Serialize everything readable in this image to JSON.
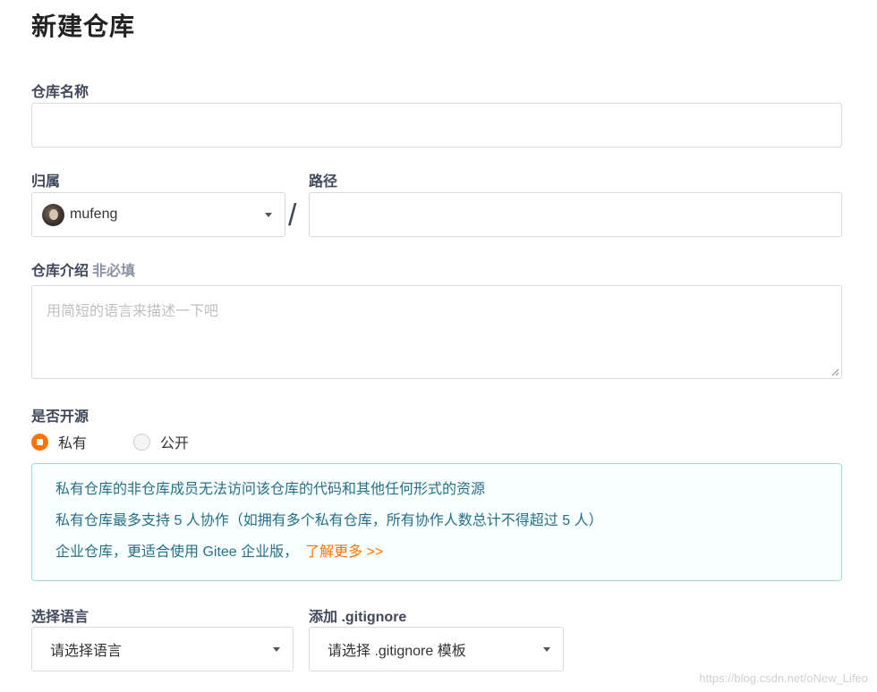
{
  "page": {
    "title": "新建仓库"
  },
  "repo_name": {
    "label": "仓库名称",
    "value": "",
    "placeholder": ""
  },
  "owner": {
    "label": "归属",
    "selected": "mufeng"
  },
  "path": {
    "label": "路径",
    "separator": "/",
    "value": ""
  },
  "description": {
    "label": "仓库介绍",
    "optional_tag": "非必填",
    "placeholder": "用简短的语言来描述一下吧"
  },
  "visibility": {
    "label": "是否开源",
    "options": [
      {
        "label": "私有",
        "checked": true
      },
      {
        "label": "公开",
        "checked": false
      }
    ]
  },
  "notice": {
    "lines": [
      "私有仓库的非仓库成员无法访问该仓库的代码和其他任何形式的资源",
      "私有仓库最多支持 5 人协作（如拥有多个私有仓库，所有协作人数总计不得超过 5 人）",
      "企业仓库，更适合使用 Gitee 企业版，"
    ],
    "link_text": "了解更多 >>"
  },
  "language": {
    "label": "选择语言",
    "selected": "请选择语言"
  },
  "gitignore": {
    "label": "添加 .gitignore",
    "selected": "请选择 .gitignore 模板"
  },
  "watermark": "https://blog.csdn.net/oNew_Lifeo",
  "colors": {
    "accent": "#fe7300",
    "info_text": "#276f86",
    "info_border": "#a9d5de",
    "label": "#40485b"
  }
}
